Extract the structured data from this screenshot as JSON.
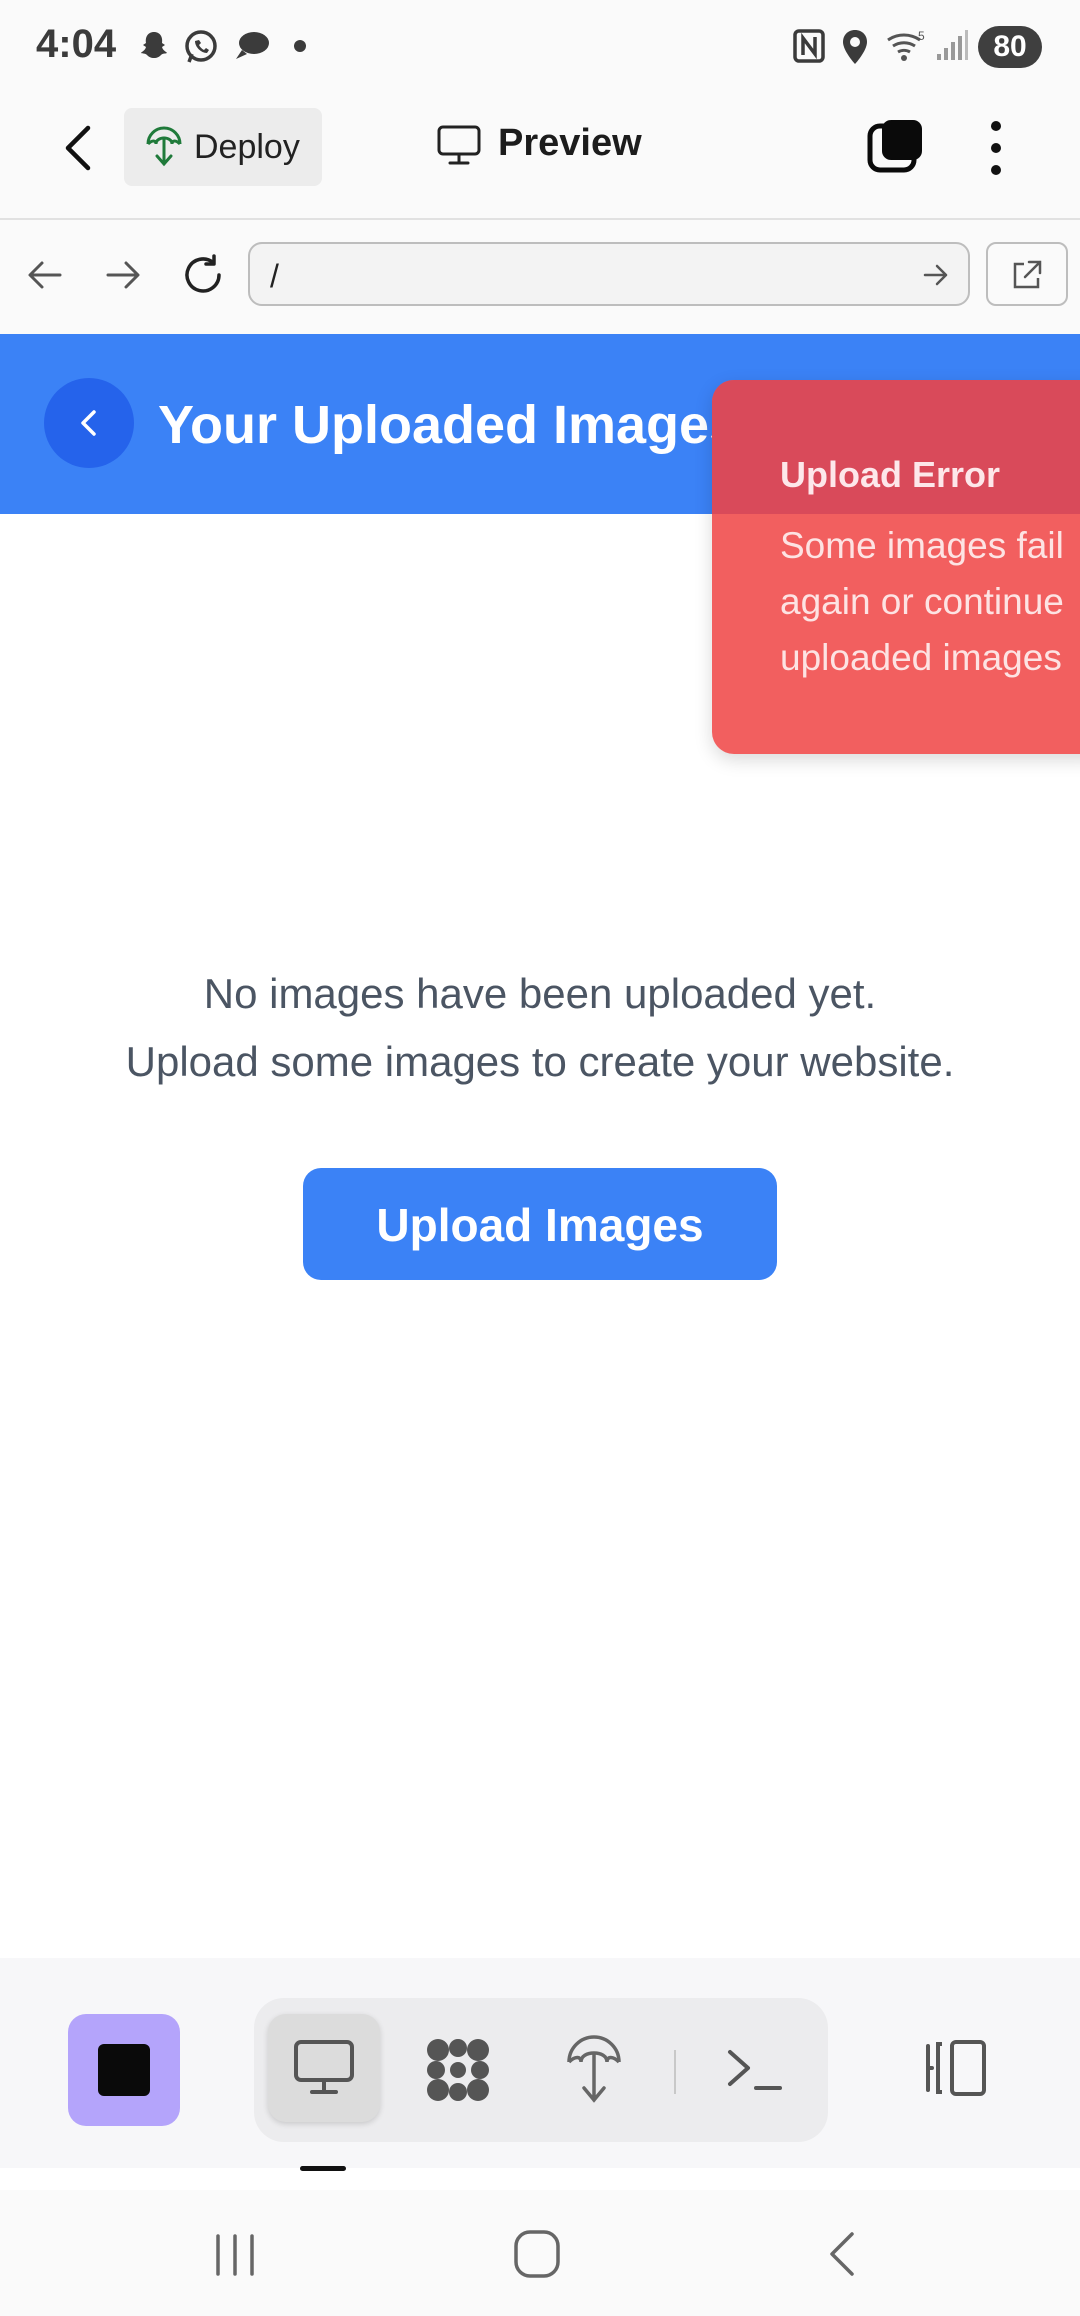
{
  "status_bar": {
    "time": "4:04",
    "battery": "80"
  },
  "app_header": {
    "deploy_label": "Deploy",
    "preview_label": "Preview"
  },
  "url_bar": {
    "value": "/"
  },
  "page": {
    "title": "Your Uploaded Images",
    "empty_line1": "No images have been uploaded yet.",
    "empty_line2": "Upload some images to create your website.",
    "upload_button": "Upload Images"
  },
  "toast": {
    "title": "Upload Error",
    "message_lines": [
      "Some images fail",
      "again or continue",
      "uploaded images"
    ]
  },
  "colors": {
    "accent": "#3b82f6",
    "toast": "#f25f5f",
    "stop": "#b4a4fb"
  },
  "icons": {
    "bottom_tools": [
      "monitor-icon",
      "apps-icon",
      "deploy-icon",
      "terminal-icon"
    ]
  }
}
